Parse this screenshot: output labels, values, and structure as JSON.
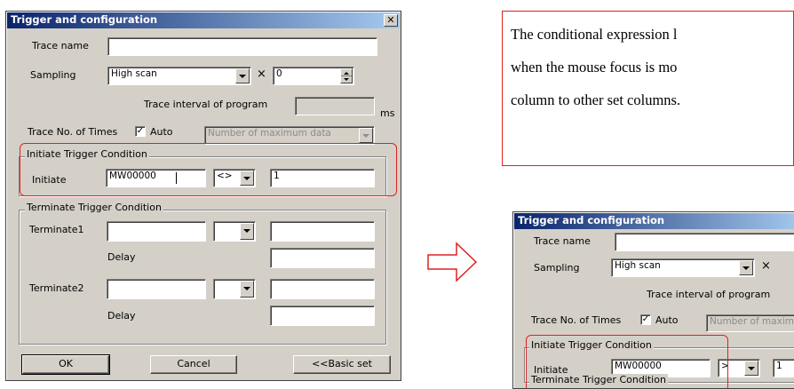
{
  "dialog_main": {
    "title": "Trigger and configuration",
    "close_glyph": "✕",
    "trace_name_label": "Trace name",
    "trace_name_value": "",
    "sampling_label": "Sampling",
    "sampling_value": "High scan",
    "multiply_symbol": "×",
    "sampling_count_value": "0",
    "trace_interval_label": "Trace interval of program",
    "trace_interval_value": "",
    "trace_interval_unit": "ms",
    "trace_no_label": "Trace No. of Times",
    "auto_checked_glyph": "✓",
    "auto_label": "Auto",
    "max_data_value": "Number of maximum data",
    "initiate_group_label": "Initiate Trigger Condition",
    "initiate_label": "Initiate",
    "initiate_address_value": "MW00000",
    "initiate_operator_value": "<>",
    "initiate_compare_value": "1",
    "terminate_group_label": "Terminate Trigger Condition",
    "terminate1_label": "Terminate1",
    "terminate1_address_value": "",
    "terminate1_operator_value": "",
    "terminate1_compare_value": "",
    "delay1_label": "Delay",
    "delay1_value": "",
    "terminate2_label": "Terminate2",
    "terminate2_address_value": "",
    "terminate2_operator_value": "",
    "terminate2_compare_value": "",
    "delay2_label": "Delay",
    "delay2_value": "",
    "ok_label": "OK",
    "cancel_label": "Cancel",
    "basic_set_label": "<<Basic set"
  },
  "note": {
    "line1": "The conditional expression l",
    "line2": "when the mouse focus is mo",
    "line3": "column to other set columns."
  },
  "dialog_secondary": {
    "title": "Trigger and configuration",
    "trace_name_label": "Trace name",
    "sampling_label": "Sampling",
    "sampling_value": "High scan",
    "multiply_symbol": "×",
    "trace_interval_label": "Trace interval of program",
    "trace_no_label": "Trace No. of Times",
    "auto_checked_glyph": "✓",
    "auto_label": "Auto",
    "max_data_value": "Number of maxim",
    "initiate_group_label": "Initiate Trigger Condition",
    "initiate_label": "Initiate",
    "initiate_address_value": "MW00000",
    "initiate_operator_value": ">",
    "initiate_compare_value": "1",
    "terminate_group_label": "Terminate Trigger Condition"
  },
  "colors": {
    "title_gradient_start": "#0a246a",
    "title_gradient_end": "#a6caf0",
    "dialog_face": "#d4d0c8",
    "highlight_red": "#e02020"
  },
  "icons": {
    "arrow": "right-arrow-outline-icon",
    "close": "close-icon",
    "dropdown": "chevron-down-icon",
    "spinner": "spinner-icon",
    "checkbox": "checkbox-icon"
  }
}
